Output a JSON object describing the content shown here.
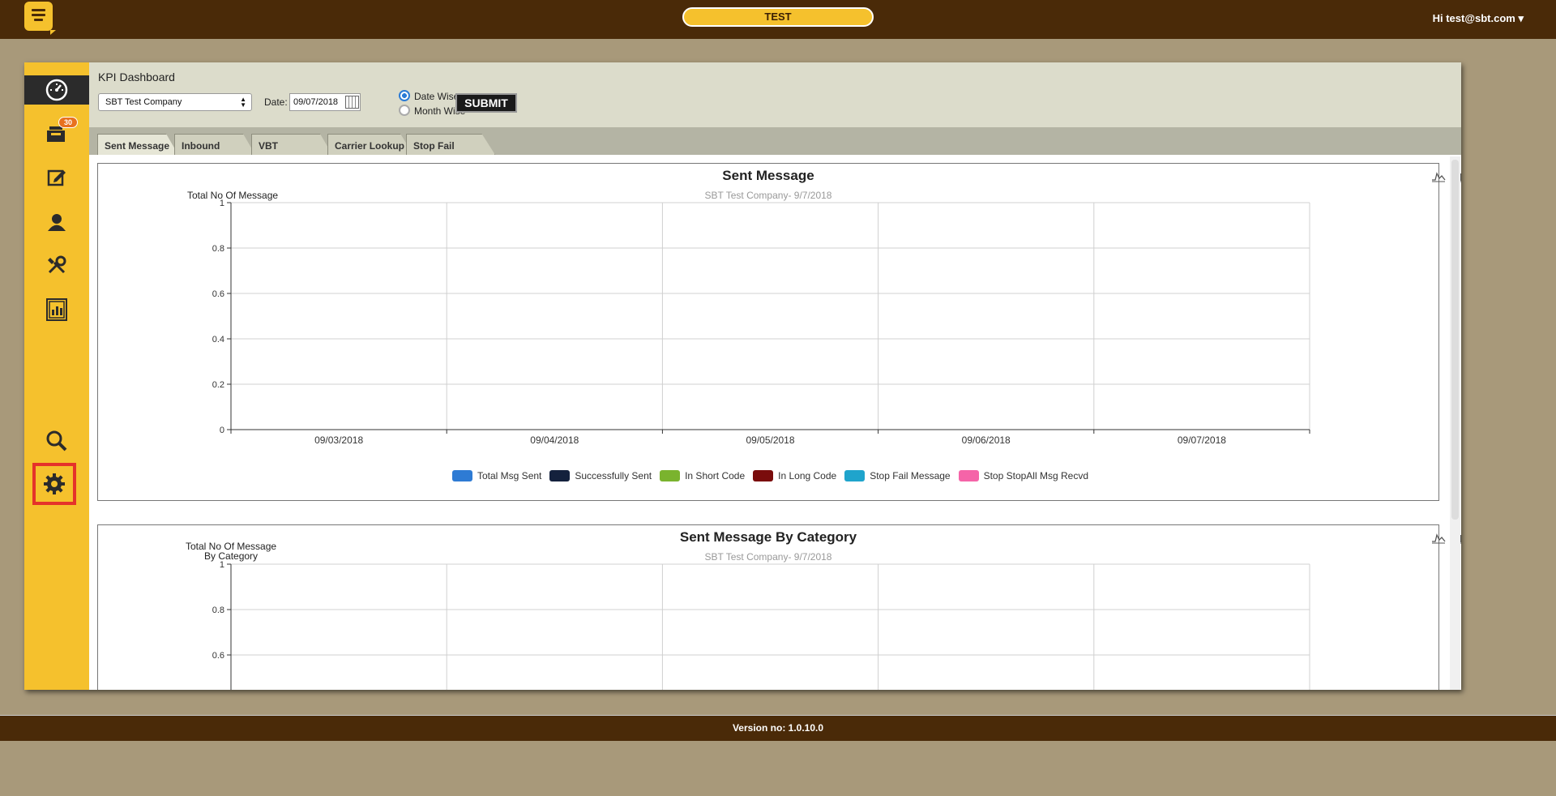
{
  "topbar": {
    "env_label": "TEST",
    "greeting": "Hi test@sbt.com ▾"
  },
  "sidebar": {
    "items": [
      {
        "icon": "dashboard-gauge-icon",
        "active": true
      },
      {
        "icon": "inbox-icon",
        "badge": "30"
      },
      {
        "icon": "compose-icon"
      },
      {
        "icon": "contacts-icon"
      },
      {
        "icon": "tools-icon"
      },
      {
        "icon": "reports-icon"
      },
      {
        "icon": "search-icon"
      },
      {
        "icon": "gear-icon",
        "highlighted": true
      }
    ]
  },
  "filters": {
    "page_title": "KPI Dashboard",
    "company": "SBT Test Company",
    "date_label": "Date:",
    "date_value": "09/07/2018",
    "radio_date": "Date Wise",
    "radio_month": "Month Wise",
    "selected_radio": "Date Wise",
    "submit_label": "SUBMIT"
  },
  "tabs": [
    {
      "label": "Sent Message",
      "active": true
    },
    {
      "label": "Inbound"
    },
    {
      "label": "VBT"
    },
    {
      "label": "Carrier Lookup"
    },
    {
      "label": "Stop Fail"
    }
  ],
  "chart_data": [
    {
      "type": "bar",
      "title": "Sent Message",
      "subtitle": "SBT Test Company- 9/7/2018",
      "ylabel": "Total No Of Message",
      "xlabel": "",
      "categories": [
        "09/03/2018",
        "09/04/2018",
        "09/05/2018",
        "09/06/2018",
        "09/07/2018"
      ],
      "ylim": [
        0,
        1
      ],
      "yticks": [
        "0",
        "0.2",
        "0.4",
        "0.6",
        "0.8",
        "1"
      ],
      "series": [
        {
          "name": "Total Msg Sent",
          "color": "#2e7bd4",
          "values": [
            0,
            0,
            0,
            0,
            0
          ]
        },
        {
          "name": "Successfully Sent",
          "color": "#14213d",
          "values": [
            0,
            0,
            0,
            0,
            0
          ]
        },
        {
          "name": "In Short Code",
          "color": "#7ab32e",
          "values": [
            0,
            0,
            0,
            0,
            0
          ]
        },
        {
          "name": "In Long Code",
          "color": "#7a0c0c",
          "values": [
            0,
            0,
            0,
            0,
            0
          ]
        },
        {
          "name": "Stop Fail Message",
          "color": "#1fa4cc",
          "values": [
            0,
            0,
            0,
            0,
            0
          ]
        },
        {
          "name": "Stop StopAll Msg Recvd",
          "color": "#f564a8",
          "values": [
            0,
            0,
            0,
            0,
            0
          ]
        }
      ],
      "grid": true,
      "legend": "bottom"
    },
    {
      "type": "bar",
      "title": "Sent Message By Category",
      "subtitle": "SBT Test Company- 9/7/2018",
      "ylabel": "Total No Of Message By Category",
      "ylabel_lines": [
        "Total No Of Message",
        "By Category"
      ],
      "xlabel": "",
      "ylim": [
        0,
        1
      ],
      "yticks": [
        "0.6",
        "0.8",
        "1"
      ],
      "grid": true
    }
  ],
  "toolbar_icons": [
    "line-chart-icon",
    "bar-chart-icon",
    "refresh-icon",
    "download-icon"
  ],
  "footer": {
    "version": "Version no: 1.0.10.0"
  }
}
